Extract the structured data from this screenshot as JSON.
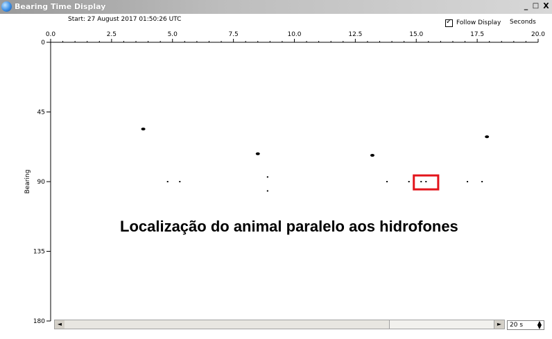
{
  "window": {
    "title": "Bearing Time Display",
    "buttons": {
      "minimize": "_",
      "maximize": "□",
      "close": "X"
    }
  },
  "header": {
    "start_label": "Start: 27 August 2017 01:50:26 UTC",
    "follow_display_label": "Follow Display",
    "follow_display_checked": true,
    "units_label": "Seconds"
  },
  "controls": {
    "span_value": "20 s",
    "scroll_left": "◄",
    "scroll_right": "►"
  },
  "annotation": {
    "text": "Localização do animal paralelo aos hidrofones",
    "highlight_color": "#e3141b"
  },
  "chart_data": {
    "type": "scatter",
    "title": "",
    "xlabel": "",
    "ylabel": "Bearing",
    "xlim": [
      0,
      20
    ],
    "ylim": [
      0,
      180
    ],
    "y_inverted": true,
    "x_ticks": [
      "0.0",
      "2.5",
      "5.0",
      "7.5",
      "10.0",
      "12.5",
      "15.0",
      "17.5",
      "20.0"
    ],
    "y_ticks": [
      "0",
      "45",
      "90",
      "135",
      "180"
    ],
    "grid": false,
    "legend": "none",
    "points": [
      {
        "x": 3.8,
        "y": 56,
        "big": true
      },
      {
        "x": 8.5,
        "y": 72,
        "big": true
      },
      {
        "x": 13.2,
        "y": 73,
        "big": true
      },
      {
        "x": 17.9,
        "y": 61,
        "big": true
      },
      {
        "x": 4.8,
        "y": 90,
        "big": false
      },
      {
        "x": 5.3,
        "y": 90,
        "big": false
      },
      {
        "x": 8.9,
        "y": 87,
        "big": false
      },
      {
        "x": 8.9,
        "y": 96,
        "big": false
      },
      {
        "x": 13.8,
        "y": 90,
        "big": false
      },
      {
        "x": 14.7,
        "y": 90,
        "big": false
      },
      {
        "x": 15.2,
        "y": 90,
        "big": false
      },
      {
        "x": 15.4,
        "y": 90,
        "big": false
      },
      {
        "x": 17.1,
        "y": 90,
        "big": false
      },
      {
        "x": 17.7,
        "y": 90,
        "big": false
      }
    ],
    "highlight_region": {
      "x": [
        14.9,
        15.9
      ],
      "y": [
        86,
        95
      ]
    }
  }
}
